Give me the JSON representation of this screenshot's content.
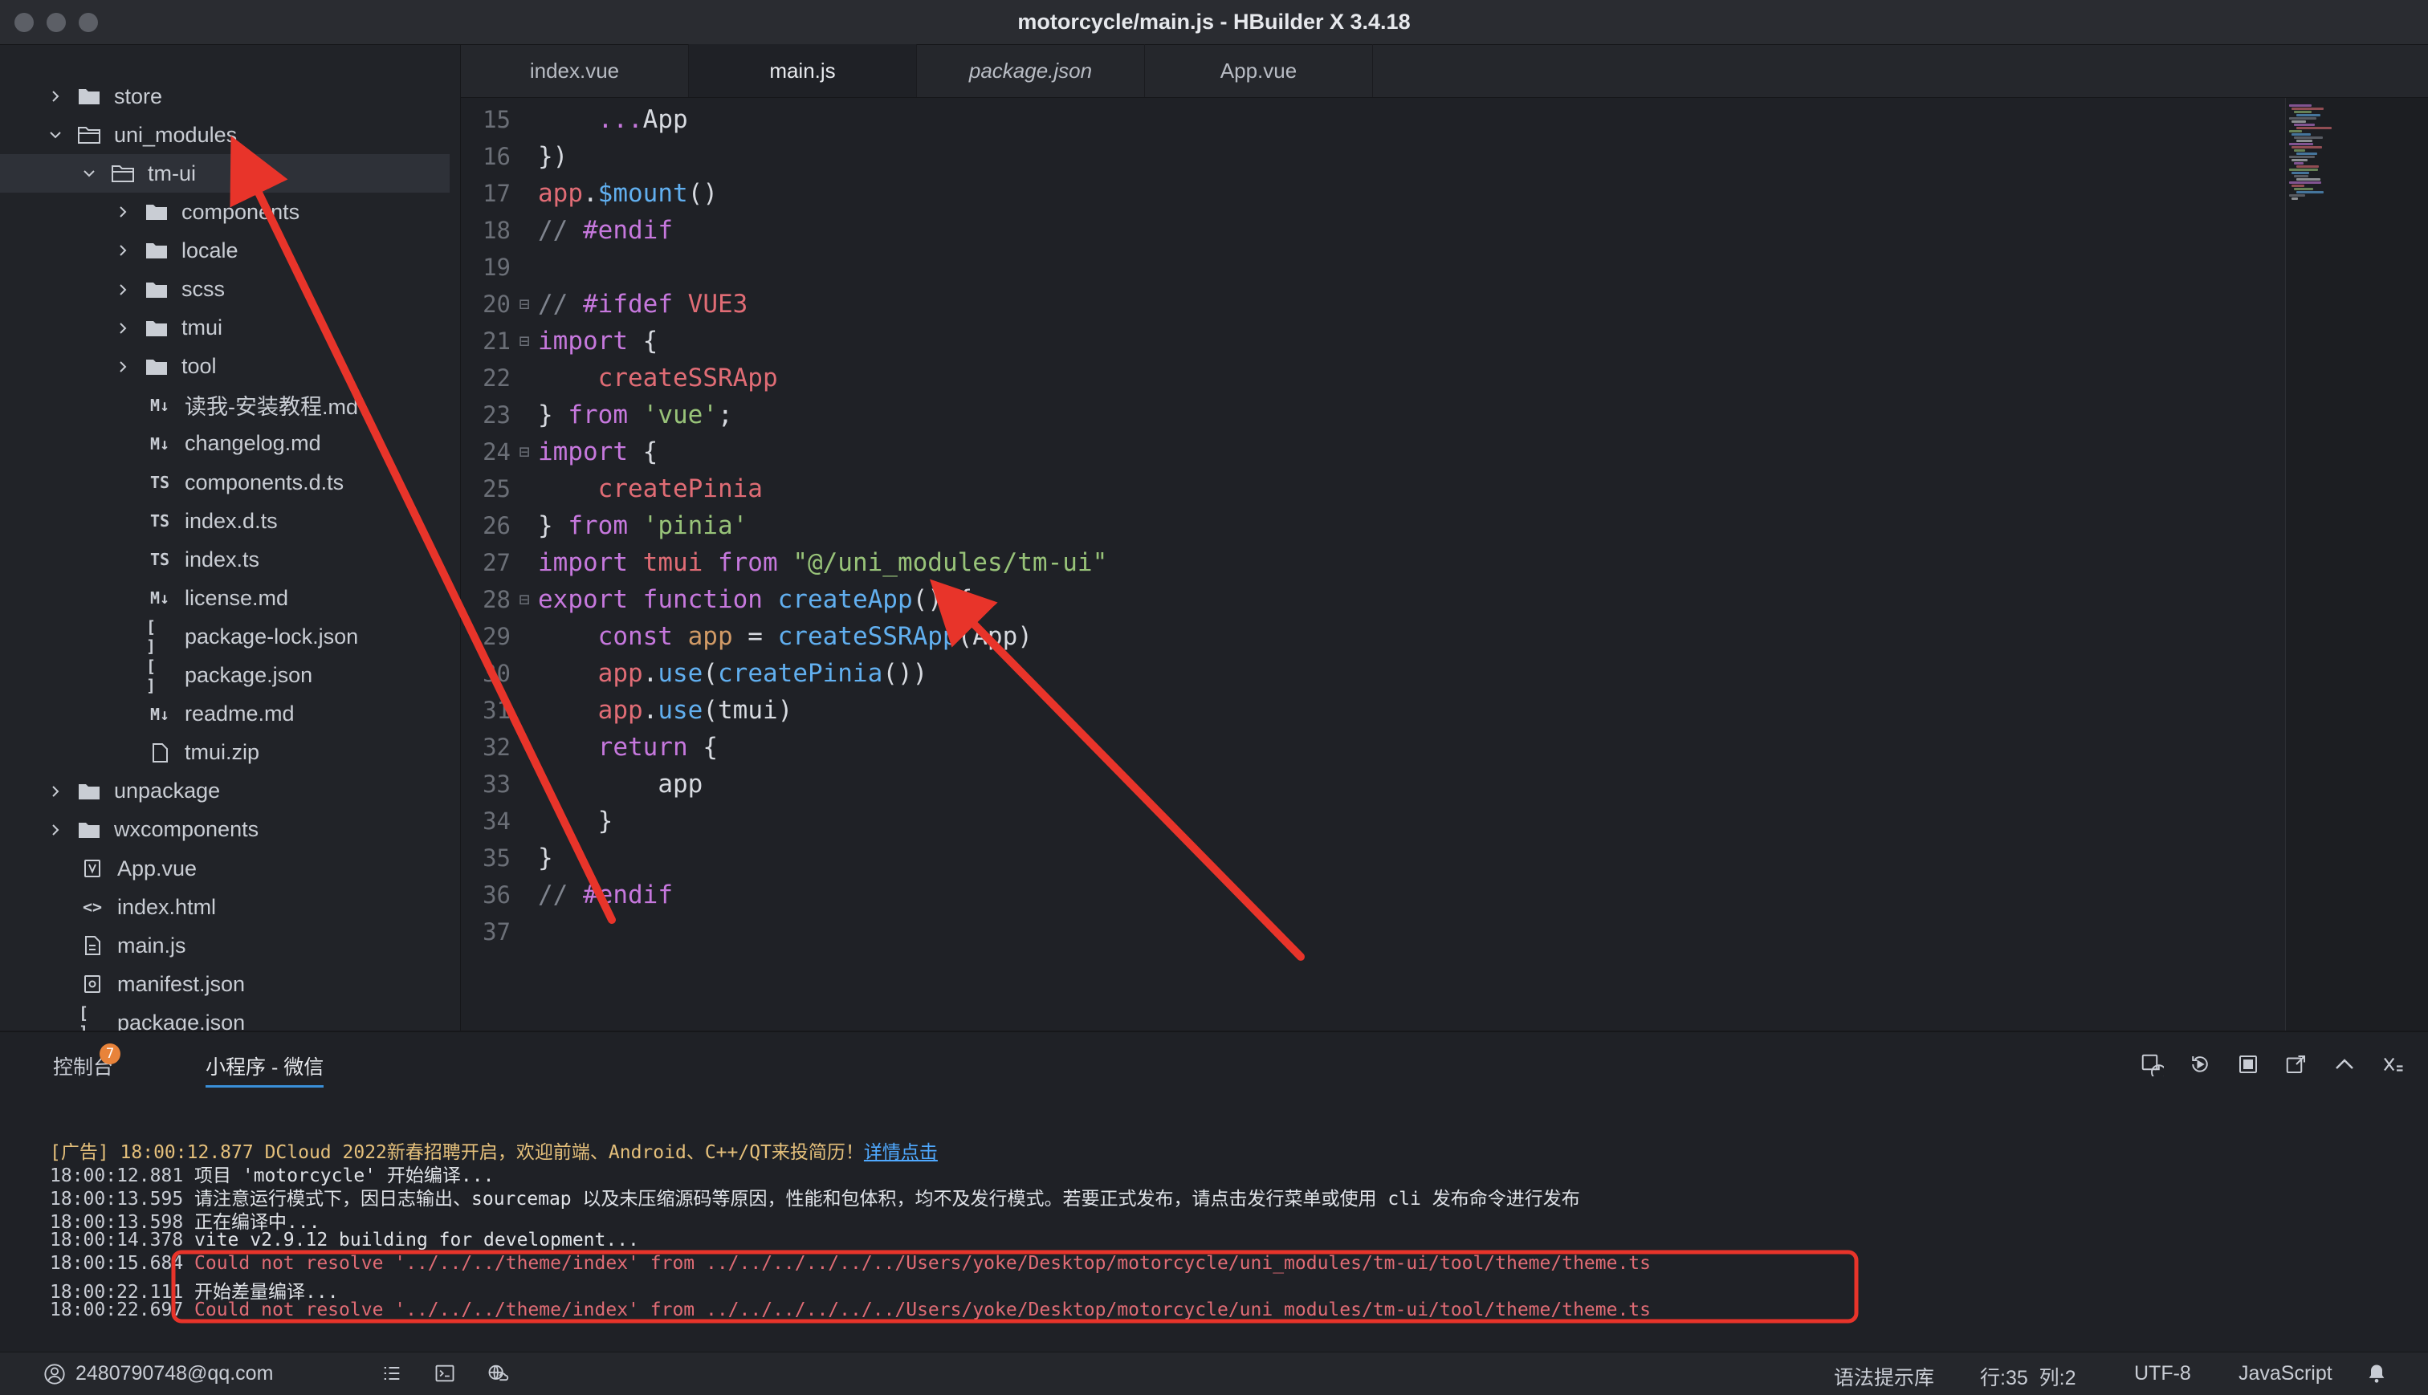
{
  "window": {
    "title": "motorcycle/main.js - HBuilder X 3.4.18"
  },
  "sidebar": {
    "items": [
      {
        "label": "store",
        "type": "folder",
        "depth": 0,
        "expanded": false
      },
      {
        "label": "uni_modules",
        "type": "folder",
        "depth": 0,
        "expanded": true
      },
      {
        "label": "tm-ui",
        "type": "folder",
        "depth": 1,
        "expanded": true,
        "selected": true
      },
      {
        "label": "components",
        "type": "folder",
        "depth": 2,
        "expanded": false
      },
      {
        "label": "locale",
        "type": "folder",
        "depth": 2,
        "expanded": false
      },
      {
        "label": "scss",
        "type": "folder",
        "depth": 2,
        "expanded": false
      },
      {
        "label": "tmui",
        "type": "folder",
        "depth": 2,
        "expanded": false
      },
      {
        "label": "tool",
        "type": "folder",
        "depth": 2,
        "expanded": false
      },
      {
        "label": "读我-安装教程.md",
        "type": "md",
        "icon_text": "M↓",
        "depth": 2
      },
      {
        "label": "changelog.md",
        "type": "md",
        "icon_text": "M↓",
        "depth": 2
      },
      {
        "label": "components.d.ts",
        "type": "ts",
        "icon_text": "TS",
        "depth": 2
      },
      {
        "label": "index.d.ts",
        "type": "ts",
        "icon_text": "TS",
        "depth": 2
      },
      {
        "label": "index.ts",
        "type": "ts",
        "icon_text": "TS",
        "depth": 2
      },
      {
        "label": "license.md",
        "type": "md",
        "icon_text": "M↓",
        "depth": 2
      },
      {
        "label": "package-lock.json",
        "type": "json",
        "icon_text": "[ ]",
        "depth": 2
      },
      {
        "label": "package.json",
        "type": "json",
        "icon_text": "[ ]",
        "depth": 2
      },
      {
        "label": "readme.md",
        "type": "md",
        "icon_text": "M↓",
        "depth": 2
      },
      {
        "label": "tmui.zip",
        "type": "file",
        "depth": 2
      },
      {
        "label": "unpackage",
        "type": "folder",
        "depth": 0,
        "expanded": false
      },
      {
        "label": "wxcomponents",
        "type": "folder",
        "depth": 0,
        "expanded": false
      },
      {
        "label": "App.vue",
        "type": "vue",
        "icon_text": "V",
        "depth": 0
      },
      {
        "label": "index.html",
        "type": "html",
        "icon_text": "<>",
        "depth": 0
      },
      {
        "label": "main.js",
        "type": "js",
        "depth": 0
      },
      {
        "label": "manifest.json",
        "type": "manifest",
        "depth": 0
      },
      {
        "label": "package.json",
        "type": "json",
        "icon_text": "[ ]",
        "depth": 0
      }
    ]
  },
  "tabs": [
    {
      "label": "index.vue",
      "active": false,
      "italic": false
    },
    {
      "label": "main.js",
      "active": true,
      "italic": false
    },
    {
      "label": "package.json",
      "active": false,
      "italic": true
    },
    {
      "label": "App.vue",
      "active": false,
      "italic": false
    }
  ],
  "editor": {
    "lines": [
      {
        "num": "15",
        "fold": false,
        "tokens": [
          [
            "",
            "    "
          ],
          [
            "c-purple",
            "..."
          ],
          [
            "c-white",
            "App"
          ]
        ]
      },
      {
        "num": "16",
        "fold": false,
        "tokens": [
          [
            "c-white",
            "})"
          ]
        ]
      },
      {
        "num": "17",
        "fold": false,
        "tokens": [
          [
            "c-red",
            "app"
          ],
          [
            "c-white",
            "."
          ],
          [
            "c-blue",
            "$mount"
          ],
          [
            "c-white",
            "()"
          ]
        ]
      },
      {
        "num": "18",
        "fold": false,
        "tokens": [
          [
            "c-gray",
            "// "
          ],
          [
            "c-purple",
            "#endif"
          ]
        ]
      },
      {
        "num": "19",
        "fold": false,
        "tokens": []
      },
      {
        "num": "20",
        "fold": true,
        "tokens": [
          [
            "c-gray",
            "// "
          ],
          [
            "c-purple",
            "#ifdef "
          ],
          [
            "c-red",
            "VUE3"
          ]
        ]
      },
      {
        "num": "21",
        "fold": true,
        "tokens": [
          [
            "c-purple",
            "import "
          ],
          [
            "c-white",
            "{"
          ]
        ]
      },
      {
        "num": "22",
        "fold": false,
        "tokens": [
          [
            "",
            "    "
          ],
          [
            "c-red",
            "createSSRApp"
          ]
        ]
      },
      {
        "num": "23",
        "fold": false,
        "tokens": [
          [
            "c-white",
            "} "
          ],
          [
            "c-purple",
            "from "
          ],
          [
            "c-green",
            "'vue'"
          ],
          [
            "c-white",
            ";"
          ]
        ]
      },
      {
        "num": "24",
        "fold": true,
        "tokens": [
          [
            "c-purple",
            "import "
          ],
          [
            "c-white",
            "{"
          ]
        ]
      },
      {
        "num": "25",
        "fold": false,
        "tokens": [
          [
            "",
            "    "
          ],
          [
            "c-red",
            "createPinia"
          ]
        ]
      },
      {
        "num": "26",
        "fold": false,
        "tokens": [
          [
            "c-white",
            "} "
          ],
          [
            "c-purple",
            "from "
          ],
          [
            "c-green",
            "'pinia'"
          ]
        ]
      },
      {
        "num": "27",
        "fold": false,
        "tokens": [
          [
            "c-purple",
            "import "
          ],
          [
            "c-red",
            "tmui "
          ],
          [
            "c-purple",
            "from "
          ],
          [
            "c-green",
            "\"@/uni_modules/tm-ui\""
          ]
        ]
      },
      {
        "num": "28",
        "fold": true,
        "tokens": [
          [
            "c-purple",
            "export "
          ],
          [
            "c-purple",
            "function "
          ],
          [
            "c-blue",
            "createApp"
          ],
          [
            "c-white",
            "() {"
          ]
        ]
      },
      {
        "num": "29",
        "fold": false,
        "tokens": [
          [
            "",
            "    "
          ],
          [
            "c-purple",
            "const "
          ],
          [
            "c-orange",
            "app "
          ],
          [
            "c-white",
            "= "
          ],
          [
            "c-blue",
            "createSSRApp"
          ],
          [
            "c-white",
            "(App)"
          ]
        ]
      },
      {
        "num": "30",
        "fold": false,
        "tokens": [
          [
            "",
            "    "
          ],
          [
            "c-red",
            "app"
          ],
          [
            "c-white",
            "."
          ],
          [
            "c-blue",
            "use"
          ],
          [
            "c-white",
            "("
          ],
          [
            "c-blue",
            "createPinia"
          ],
          [
            "c-white",
            "())"
          ]
        ]
      },
      {
        "num": "31",
        "fold": false,
        "tokens": [
          [
            "",
            "    "
          ],
          [
            "c-red",
            "app"
          ],
          [
            "c-white",
            "."
          ],
          [
            "c-blue",
            "use"
          ],
          [
            "c-white",
            "(tmui)"
          ]
        ]
      },
      {
        "num": "32",
        "fold": false,
        "tokens": [
          [
            "",
            "    "
          ],
          [
            "c-purple",
            "return "
          ],
          [
            "c-white",
            "{"
          ]
        ]
      },
      {
        "num": "33",
        "fold": false,
        "tokens": [
          [
            "",
            "        "
          ],
          [
            "c-white",
            "app"
          ]
        ]
      },
      {
        "num": "34",
        "fold": false,
        "tokens": [
          [
            "",
            "    "
          ],
          [
            "c-white",
            "}"
          ]
        ]
      },
      {
        "num": "35",
        "fold": false,
        "tokens": [
          [
            "c-white",
            "}"
          ]
        ]
      },
      {
        "num": "36",
        "fold": false,
        "tokens": [
          [
            "c-gray",
            "// "
          ],
          [
            "c-purple",
            "#endif"
          ]
        ]
      },
      {
        "num": "37",
        "fold": false,
        "tokens": []
      }
    ]
  },
  "panel": {
    "tabs": [
      {
        "label": "控制台",
        "badge": "7",
        "active": false
      },
      {
        "label": "小程序 - 微信",
        "active": true
      }
    ],
    "tools": [
      "reload-icon",
      "restart-icon",
      "stop-icon",
      "export-icon",
      "collapse-icon",
      "clear-icon"
    ],
    "logs": [
      {
        "ts": "[广告] 18:00:12.877",
        "kind": "ad",
        "text": " DCloud 2022新春招聘开启，欢迎前端、Android、C++/QT来投简历！",
        "link": "详情点击"
      },
      {
        "ts": "18:00:12.881",
        "kind": "normal",
        "text": " 项目 'motorcycle' 开始编译..."
      },
      {
        "ts": "18:00:13.595",
        "kind": "normal",
        "text": " 请注意运行模式下，因日志输出、sourcemap 以及未压缩源码等原因，性能和包体积，均不及发行模式。若要正式发布，请点击发行菜单或使用 cli 发布命令进行发布"
      },
      {
        "ts": "18:00:13.598",
        "kind": "normal",
        "text": " 正在编译中..."
      },
      {
        "ts": "18:00:14.378",
        "kind": "normal",
        "text": " vite v2.9.12 building for development..."
      },
      {
        "ts": "18:00:15.684",
        "kind": "error",
        "text": " Could not resolve '../../../theme/index' from ../../../../../../Users/yoke/Desktop/motorcycle/uni_modules/tm-ui/tool/theme/theme.ts"
      },
      {
        "ts": "18:00:22.111",
        "kind": "normal",
        "text": " 开始差量编译..."
      },
      {
        "ts": "18:00:22.697",
        "kind": "error",
        "text": " Could not resolve '../../../theme/index' from ../../../../../../Users/yoke/Desktop/motorcycle/uni_modules/tm-ui/tool/theme/theme.ts"
      }
    ]
  },
  "status": {
    "user": "2480790748@qq.com",
    "syntax_lib": "语法提示库",
    "position": "行:35  列:2",
    "encoding": "UTF-8",
    "language": "JavaScript"
  },
  "colors": {
    "annotation_red": "#e8342a",
    "accent_blue": "#3a8fd8",
    "error_red": "#e06c75"
  }
}
